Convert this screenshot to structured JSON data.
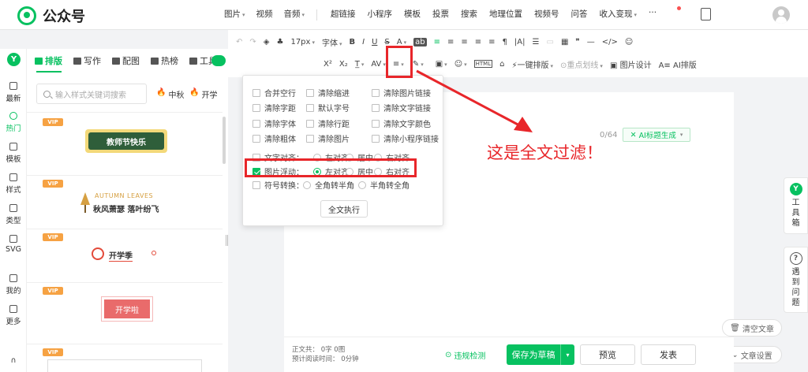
{
  "app": {
    "name": "公众号"
  },
  "topbar": {
    "group1": [
      "图片",
      "视频",
      "音频"
    ],
    "group2": [
      "超链接",
      "小程序",
      "模板",
      "投票",
      "搜索",
      "地理位置",
      "视频号",
      "问答",
      "收入变现"
    ],
    "more": "···"
  },
  "leftnav": {
    "items": [
      "最新",
      "热门",
      "模板",
      "样式",
      "类型",
      "SVG",
      "我的",
      "更多"
    ]
  },
  "panel": {
    "tabs": [
      "排版",
      "写作",
      "配图",
      "热榜",
      "工具"
    ],
    "search_placeholder": "输入样式关键词搜索",
    "hot_tags": [
      "中秋",
      "开学"
    ],
    "vip_label": "VIP",
    "cards": [
      "教师节快乐",
      "AUTUMN LEAVES",
      "秋风萧瑟 落叶纷飞",
      "开学季",
      "开学啦"
    ]
  },
  "toolbar": {
    "row1": [
      "↶",
      "↷",
      "◈",
      "♣",
      "17px",
      "字体",
      "B",
      "I",
      "U",
      "S",
      "A",
      "ab",
      "≡",
      "≡",
      "≡",
      "≡",
      "≡",
      "¶",
      "|A|",
      "☰",
      "▭",
      "▦",
      "❞",
      "—",
      "</>",
      "☺"
    ],
    "row2": [
      "X²",
      "X₂",
      "T̲",
      "AV",
      "≡"
    ],
    "one_key": "一键排版",
    "key_line": "重点划线",
    "img_design": "图片设计",
    "ai_layout": "AI排版"
  },
  "editor": {
    "counter": "0/64",
    "ai_title": "AI标题生成"
  },
  "popup": {
    "options": [
      [
        "合并空行",
        "清除缩进",
        "清除图片链接"
      ],
      [
        "清除字距",
        "默认字号",
        "清除文字链接"
      ],
      [
        "清除字体",
        "清除行距",
        "清除文字颜色"
      ],
      [
        "清除粗体",
        "清除图片",
        "清除小程序链接"
      ]
    ],
    "text_align": {
      "label": "文字对齐：",
      "choices": [
        "左对齐",
        "居中",
        "右对齐"
      ]
    },
    "image_float": {
      "label": "图片浮动：",
      "choices": [
        "左对齐",
        "居中",
        "右对齐"
      ],
      "selected": "左对齐",
      "checked": true
    },
    "symbol_convert": {
      "label": "符号转换：",
      "choices": [
        "全角转半角",
        "半角转全角"
      ]
    },
    "execute": "全文执行"
  },
  "annotation": {
    "text": "这是全文过滤！",
    "color": "#e8262a"
  },
  "rightdock": {
    "toolbox": "工具箱",
    "problems": "遇到问题"
  },
  "side_buttons": {
    "clear": "清空文章",
    "settings": "文章设置"
  },
  "footer": {
    "stats_line1": "正文共： 0字 0图",
    "stats_line2": "预计阅读时间： 0分钟",
    "check": "违规检测",
    "save": "保存为草稿",
    "preview": "预览",
    "publish": "发表"
  },
  "colors": {
    "accent": "#07c160",
    "vip": "#f6a243",
    "highlight": "#e8262a"
  }
}
